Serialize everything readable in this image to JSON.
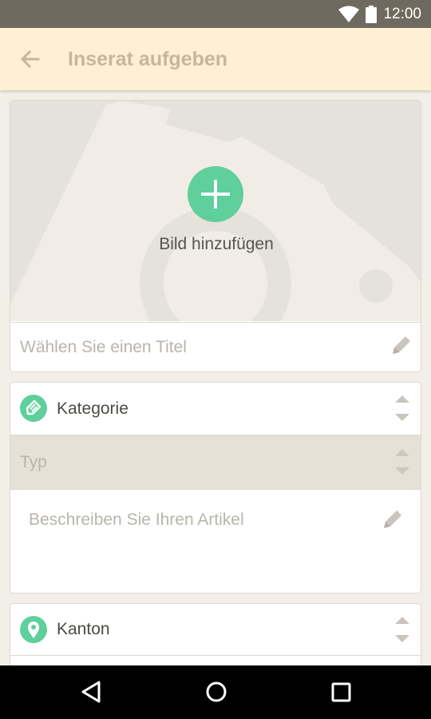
{
  "status_bar": {
    "time": "12:00"
  },
  "app_bar": {
    "title": "Inserat aufgeben",
    "back_icon": "arrow-left-icon"
  },
  "photo": {
    "add_label": "Bild hinzufügen",
    "icon": "plus-icon",
    "accent": "#5fcf9c"
  },
  "title_field": {
    "placeholder": "Wählen Sie einen Titel",
    "icon": "pencil-icon"
  },
  "category_card": {
    "category_label": "Kategorie",
    "category_icon": "tag-icon",
    "type_label": "Typ",
    "description_placeholder": "Beschreiben Sie Ihren Artikel"
  },
  "location_card": {
    "kanton_label": "Kanton",
    "icon": "map-pin-icon"
  },
  "nav_bar": {
    "back": "back-triangle-icon",
    "home": "home-circle-icon",
    "recents": "recents-square-icon"
  }
}
